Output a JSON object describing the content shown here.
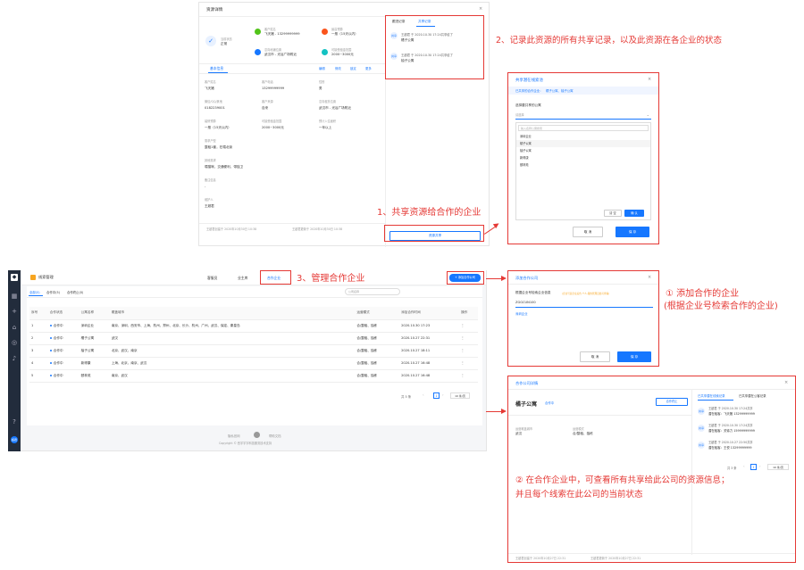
{
  "detail": {
    "title": "资源详情",
    "status_label": "当前状态",
    "status_value": "正常",
    "info": [
      {
        "label": "客户姓名",
        "value": "飞天猪 - 13299999999"
      },
      {
        "label": "最高预算",
        "value": "一般（15天以内）"
      },
      {
        "label": "意向地铺位置",
        "value": "武汉市 - 光谷广场附近"
      },
      {
        "label": "可接受租金范围",
        "value": "2000~3000元"
      }
    ],
    "tabs": [
      "基本信息",
      "编辑",
      "修改",
      "锁定",
      "更多"
    ],
    "fields": [
      {
        "label": "客户姓名",
        "value": "飞天猪"
      },
      {
        "label": "客户电话",
        "value": "13299999999"
      },
      {
        "label": "性别",
        "value": "男"
      },
      {
        "label": "微信/QQ/其他",
        "value": "0182239001"
      },
      {
        "label": "客户来源",
        "value": "自来"
      },
      {
        "label": "意向租赁位置",
        "value": "武汉市 - 光谷广场附近"
      },
      {
        "label": "装修预算",
        "value": "一般（15天以内）"
      },
      {
        "label": "可接受租金范围",
        "value": "2000~3000元"
      },
      {
        "label": "预计入住面积",
        "value": "一年以上"
      },
      {
        "label": "需求户型",
        "value": "整租1套，在喂北街"
      },
      {
        "label": "",
        "value": ""
      },
      {
        "label": "",
        "value": ""
      },
      {
        "label": "其他需求",
        "value": "喂猫咪，交通便利，带独卫"
      },
      {
        "label": "",
        "value": ""
      },
      {
        "label": "",
        "value": ""
      },
      {
        "label": "备注信息",
        "value": "-"
      },
      {
        "label": "",
        "value": ""
      },
      {
        "label": "",
        "value": ""
      },
      {
        "label": "维护人",
        "value": "王超君"
      },
      {
        "label": "",
        "value": ""
      },
      {
        "label": "",
        "value": ""
      }
    ],
    "footer_left": "王超君创建于 2020年10月30日 10:38",
    "footer_right": "王超君更新于 2020年10月30日 10:38",
    "side_tabs": [
      "跟进记录",
      "共享记录"
    ],
    "share_records": [
      {
        "text": "王超君 于 2020.10.30 17:24共享给了",
        "company": "橘子公寓"
      },
      {
        "text": "王超君 于 2020.10.30 17:24共享给了",
        "company": "柚子公寓"
      }
    ],
    "share_button": "资源共享"
  },
  "ann": {
    "a1": "1、共享资源给合作的企业",
    "a2": "2、记录此资源的所有共享记录，以及此资源在各企业的状态",
    "a3": "3、管理合作企业",
    "a4a": "① 添加合作的企业",
    "a4b": "(根据企业号检索合作的企业)",
    "a5a": "② 在合作企业中，可查看所有共享给此公司的资源信息；",
    "a5b": "并且每个线索在此公司的当前状态"
  },
  "share_modal": {
    "title": "共享潜在线索池",
    "shared_label": "已共享的合作企业：",
    "shared_value": "橘子公寓、柚子公寓",
    "select_label": "选择要共享的公寓",
    "select_placeholder": "请选择",
    "search_placeholder": "输入名称公寓搜索",
    "options": [
      "深圳企业",
      "橘子公寓",
      "柚子公寓",
      "新得康",
      "颐林苑"
    ],
    "inner_cancel": "清 空",
    "inner_ok": "确 认",
    "cancel": "取 消",
    "save": "保 存"
  },
  "main": {
    "app_title": "线索管理",
    "nav": [
      "我的客户",
      "公海客户",
      "线索管理",
      "我的任务"
    ],
    "nav_visible": [
      "客服员",
      "业主库",
      "合作企业"
    ],
    "add_button": "+ 添加合作公司",
    "filters": [
      "全部(5)",
      "合作中(5)",
      "合作终止(0)"
    ],
    "search_placeholder": "公司名称",
    "columns": [
      "序号",
      "合作状态",
      "公寓名称",
      "覆盖城市",
      "运营模式",
      "添加合作时间",
      "操作"
    ],
    "rows": [
      [
        "1",
        "合作中",
        "深圳企业",
        "南京、深圳、西安市、上海、杭州、郑州、北京、长沙、杭州、广州、武汉、保定、秦皇岛",
        "合/整租、独栋",
        "2020.10.30 17:23",
        "⋮"
      ],
      [
        "2",
        "合作中",
        "橘子公寓",
        "武汉",
        "合/整租、独栋",
        "2020.10.27 22:31",
        "⋮"
      ],
      [
        "3",
        "合作中",
        "柚子公寓",
        "北京、武汉、南京",
        "合/整租、独栋",
        "2020.10.27 18:11",
        "⋮"
      ],
      [
        "4",
        "合作中",
        "新得康",
        "上海、北京、南京、武汉",
        "合/整租、独栋",
        "2020.10.27 16:48",
        "⋮"
      ],
      [
        "5",
        "合作中",
        "颐林苑",
        "南京、武汉",
        "合/整租、独栋",
        "2020.10.27 16:48",
        "⋮"
      ]
    ],
    "total": "共 5 条",
    "page": "1",
    "page_size": "10 条/页",
    "footer_links": [
      "隐私官网",
      "帮助文档"
    ],
    "copyright": "Copyright © 西宇宇宇科技服务技术支持"
  },
  "add_modal": {
    "title": "添加合作公司",
    "label": "根据企业号检索企业信息",
    "hint": "(企业号是企业后台-个人-我的管理员处可查看)",
    "input_value": "ZGGCUN100",
    "result": "深圳企业",
    "cancel": "取 消",
    "save": "保 存"
  },
  "coop_modal": {
    "title": "合作公司详情",
    "name": "橘子公寓",
    "status": "合作中",
    "stop_button": "合作终止",
    "city_label": "运营覆盖城市",
    "city_value": "武汉",
    "mode_label": "运营模式",
    "mode_value": "合/整租、独栋",
    "tabs": [
      "已共享潜在线索记录",
      "已共享潜在公客记录"
    ],
    "records": [
      {
        "text": "王超君 于 2020.10.30 17:24共享",
        "detail": "潜在租客：飞天猪 13299999999"
      },
      {
        "text": "王超君 于 2020.10.30 17:24共享",
        "detail": "潜在租客：关徐力 15999999999"
      },
      {
        "text": "王超君 于 2020.10.27 22:50共享",
        "detail": "潜在租客：王悦 13299999999"
      }
    ],
    "total": "共 3 条",
    "page": "1",
    "page_size": "10 条/页",
    "footer_left": "王超君创建于 2020年10月27日 22:31",
    "footer_right": "王超君更新于 2020年10月27日 22:31"
  },
  "colors": {
    "accent": "#1677ff",
    "annotation": "#e53935",
    "sidebar": "#222c3c",
    "app_icon": "#f7a520"
  }
}
